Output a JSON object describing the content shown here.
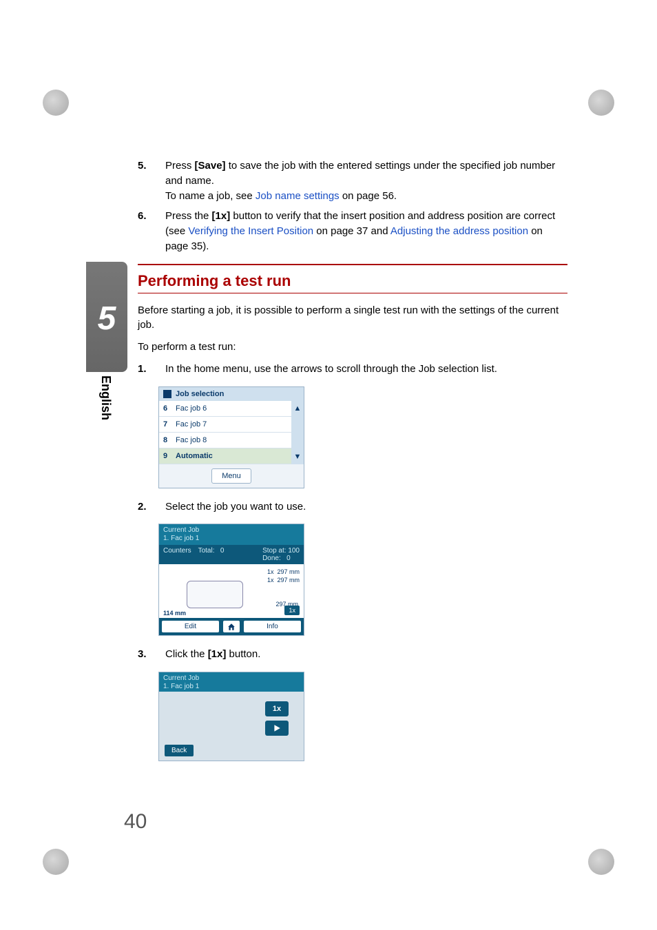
{
  "chapter_number": "5",
  "language_tab": "English",
  "page_number": "40",
  "steps_top": [
    {
      "n": "5.",
      "parts": [
        {
          "t": "Press "
        },
        {
          "t": "[Save]",
          "b": true
        },
        {
          "t": " to save the job with the entered settings under the specified job number and name."
        }
      ],
      "line2_parts": [
        {
          "t": "To name a job, see "
        },
        {
          "t": "Job name settings",
          "link": true
        },
        {
          "t": " on page 56."
        }
      ]
    },
    {
      "n": "6.",
      "parts": [
        {
          "t": "Press the "
        },
        {
          "t": "[1x]",
          "b": true
        },
        {
          "t": " button to verify that the insert position and address position are correct (see "
        },
        {
          "t": "Verifying the Insert Position",
          "link": true
        },
        {
          "t": " on page 37 and "
        },
        {
          "t": "Adjusting the address position",
          "link": true
        },
        {
          "t": " on page 35)."
        }
      ]
    }
  ],
  "section_title": "Performing a test run",
  "intro": "Before starting a job, it is possible to perform a single test run with the settings of the current job.",
  "lead": "To perform a test run:",
  "steps_main": [
    {
      "n": "1.",
      "txt": "In the home menu, use the arrows to scroll through the Job selection list."
    },
    {
      "n": "2.",
      "txt": "Select the job you want to use."
    },
    {
      "n": "3.",
      "txt_parts": [
        {
          "t": "Click the "
        },
        {
          "t": "[1x]",
          "b": true
        },
        {
          "t": " button."
        }
      ]
    }
  ],
  "panel1": {
    "title": "Job selection",
    "rows": [
      {
        "idx": "6",
        "label": "Fac job 6",
        "sel": false
      },
      {
        "idx": "7",
        "label": "Fac job 7",
        "sel": false
      },
      {
        "idx": "8",
        "label": "Fac job 8",
        "sel": false
      },
      {
        "idx": "9",
        "label": "Automatic",
        "sel": true
      }
    ],
    "menu_btn": "Menu",
    "scroll_up": "▲",
    "scroll_down": "▼"
  },
  "panel2": {
    "hdr1": "Current Job",
    "hdr2": "1. Fac job 1",
    "counters_label": "Counters",
    "total_label": "Total:",
    "total_value": "0",
    "stop_label": "Stop at:",
    "stop_value": "100",
    "done_label": "Done:",
    "done_value": "0",
    "feed_lines": "1x  297 mm\n1x  297 mm\n\n\n     297 mm",
    "env_size": "114 mm",
    "onex": "1x",
    "edit_btn": "Edit",
    "info_btn": "Info"
  },
  "panel3": {
    "hdr1": "Current Job",
    "hdr2": "1. Fac job 1",
    "onex": "1x",
    "back": "Back"
  }
}
